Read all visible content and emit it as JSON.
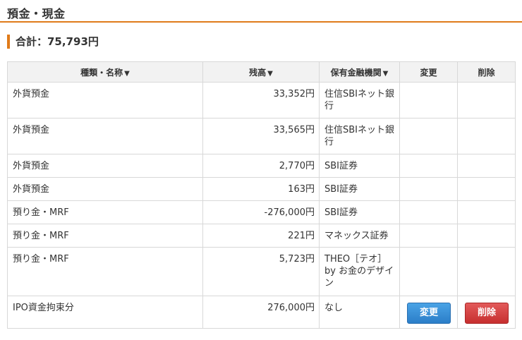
{
  "header": {
    "title": "預金・現金"
  },
  "total": {
    "label": "合計：75,793円"
  },
  "table": {
    "columns": [
      {
        "label": "種類・名称",
        "sortable": true
      },
      {
        "label": "残高",
        "sortable": true
      },
      {
        "label": "保有金融機関",
        "sortable": true
      },
      {
        "label": "変更",
        "sortable": false
      },
      {
        "label": "削除",
        "sortable": false
      }
    ],
    "sort_indicator": "▼",
    "rows": [
      {
        "type": "外貨預金",
        "balance": "33,352円",
        "institution": "住信SBIネット銀行"
      },
      {
        "type": "外貨預金",
        "balance": "33,565円",
        "institution": "住信SBIネット銀行"
      },
      {
        "type": "外貨預金",
        "balance": "2,770円",
        "institution": "SBI証券"
      },
      {
        "type": "外貨預金",
        "balance": "163円",
        "institution": "SBI証券"
      },
      {
        "type": "預り金・MRF",
        "balance": "-276,000円",
        "institution": "SBI証券"
      },
      {
        "type": "預り金・MRF",
        "balance": "221円",
        "institution": "マネックス証券"
      },
      {
        "type": "預り金・MRF",
        "balance": "5,723円",
        "institution": "THEO［テオ］by お金のデザイン"
      },
      {
        "type": "IPO資金拘束分",
        "balance": "276,000円",
        "institution": "なし",
        "edit_label": "変更",
        "delete_label": "削除"
      }
    ]
  },
  "colors": {
    "accent": "#e07b1a",
    "edit_button": "#2b7ec8",
    "delete_button": "#c72f2f"
  }
}
